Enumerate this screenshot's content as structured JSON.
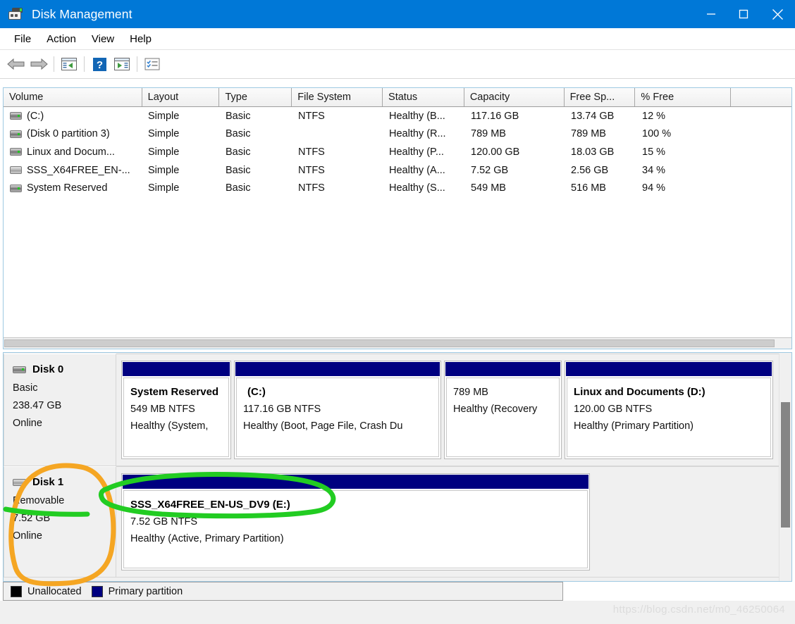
{
  "window": {
    "title": "Disk Management",
    "icon": "disk-management-icon",
    "accent_color": "#0078d7",
    "controls": {
      "minimize": "minimize-icon",
      "maximize": "maximize-icon",
      "close": "close-icon"
    }
  },
  "menu": {
    "items": [
      "File",
      "Action",
      "View",
      "Help"
    ]
  },
  "toolbar": {
    "buttons": [
      {
        "name": "back-icon",
        "glyph": "back-arrow"
      },
      {
        "name": "forward-icon",
        "glyph": "forward-arrow"
      },
      {
        "name": "show-hide-console-tree-icon",
        "glyph": "tree-pane-left"
      },
      {
        "name": "help-icon",
        "glyph": "question-mark"
      },
      {
        "name": "show-hide-action-pane-icon",
        "glyph": "tree-pane-right"
      },
      {
        "name": "properties-icon",
        "glyph": "checklist"
      }
    ]
  },
  "volume_table": {
    "columns": [
      "Volume",
      "Layout",
      "Type",
      "File System",
      "Status",
      "Capacity",
      "Free Sp...",
      "% Free",
      ""
    ],
    "rows": [
      {
        "volume": "(C:)",
        "icon": "volume-drive-icon",
        "layout": "Simple",
        "type": "Basic",
        "file_system": "NTFS",
        "status": "Healthy (B...",
        "capacity": "117.16 GB",
        "free_space": "13.74 GB",
        "percent_free": "12 %"
      },
      {
        "volume": "(Disk 0 partition 3)",
        "icon": "volume-drive-icon",
        "layout": "Simple",
        "type": "Basic",
        "file_system": "",
        "status": "Healthy (R...",
        "capacity": "789 MB",
        "free_space": "789 MB",
        "percent_free": "100 %"
      },
      {
        "volume": "Linux and Docum...",
        "icon": "volume-drive-icon",
        "layout": "Simple",
        "type": "Basic",
        "file_system": "NTFS",
        "status": "Healthy (P...",
        "capacity": "120.00 GB",
        "free_space": "18.03 GB",
        "percent_free": "15 %"
      },
      {
        "volume": "SSS_X64FREE_EN-...",
        "icon": "volume-removable-icon",
        "layout": "Simple",
        "type": "Basic",
        "file_system": "NTFS",
        "status": "Healthy (A...",
        "capacity": "7.52 GB",
        "free_space": "2.56 GB",
        "percent_free": "34 %"
      },
      {
        "volume": "System Reserved",
        "icon": "volume-drive-icon",
        "layout": "Simple",
        "type": "Basic",
        "file_system": "NTFS",
        "status": "Healthy (S...",
        "capacity": "549 MB",
        "free_space": "516 MB",
        "percent_free": "94 %"
      }
    ]
  },
  "disks": [
    {
      "name": "Disk 0",
      "icon": "disk-fixed-icon",
      "type": "Basic",
      "size": "238.47 GB",
      "state": "Online",
      "partitions": [
        {
          "label": "System Reserved",
          "size": "549 MB NTFS",
          "health": "Healthy (System,",
          "bar_color": "#000080"
        },
        {
          "label": "(C:)",
          "size": "117.16 GB NTFS",
          "health": "Healthy (Boot, Page File, Crash Du",
          "bar_color": "#000080"
        },
        {
          "label": "",
          "size": "789 MB",
          "health": "Healthy (Recovery",
          "bar_color": "#000080"
        },
        {
          "label": "Linux and Documents  (D:)",
          "size": "120.00 GB NTFS",
          "health": "Healthy (Primary Partition)",
          "bar_color": "#000080"
        }
      ]
    },
    {
      "name": "Disk 1",
      "icon": "disk-removable-icon",
      "type": "Removable",
      "size": "7.52 GB",
      "state": "Online",
      "partitions": [
        {
          "label": "SSS_X64FREE_EN-US_DV9  (E:)",
          "size": "7.52 GB NTFS",
          "health": "Healthy (Active, Primary Partition)",
          "bar_color": "#000080"
        }
      ]
    }
  ],
  "legend": {
    "items": [
      {
        "label": "Unallocated",
        "color": "#000000"
      },
      {
        "label": "Primary partition",
        "color": "#000080"
      }
    ]
  },
  "annotations": [
    {
      "name": "orange-circle-disk1",
      "color": "#f5a623",
      "shape": "ellipse-freehand"
    },
    {
      "name": "green-circle-volume-label",
      "color": "#22cc22",
      "shape": "ellipse-freehand"
    },
    {
      "name": "green-underline-removable",
      "color": "#22cc22",
      "shape": "line-freehand"
    }
  ],
  "watermark": {
    "text": "https://blog.csdn.net/m0_46250064"
  }
}
